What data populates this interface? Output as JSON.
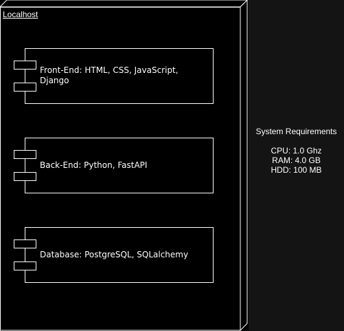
{
  "node": {
    "title": "Localhost"
  },
  "components": [
    {
      "label": "Front-End: HTML, CSS, JavaScript,\nDjango"
    },
    {
      "label": "Back-End: Python, FastAPI"
    },
    {
      "label": "Database: PostgreSQL, SQLalchemy"
    }
  ],
  "requirements": {
    "title": "System Requirements",
    "lines": [
      "CPU: 1.0 Ghz",
      "RAM: 4.0 GB",
      "HDD: 100 MB"
    ]
  },
  "colors": {
    "background": "#000000",
    "stroke": "#ffffff",
    "panel": "#141414"
  }
}
